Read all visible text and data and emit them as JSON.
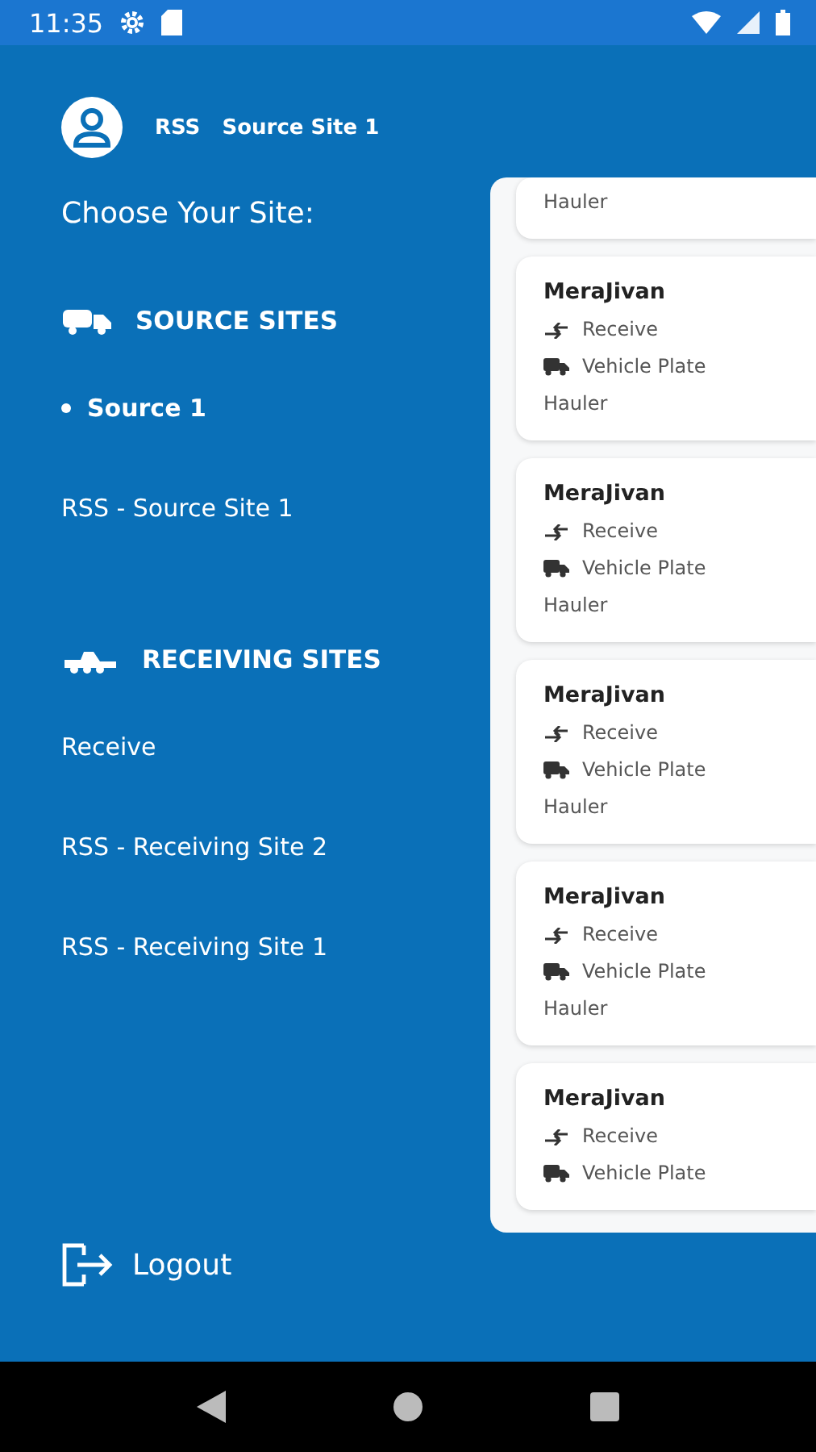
{
  "status_bar": {
    "time": "11:35"
  },
  "user": {
    "prefix": "RSS",
    "site": "Source Site 1"
  },
  "prompt": "Choose Your Site:",
  "sections": [
    {
      "kind": "source",
      "title": "SOURCE SITES",
      "items": [
        {
          "label": "Source 1",
          "selected": true
        },
        {
          "label": "RSS - Source Site 1",
          "selected": false
        }
      ]
    },
    {
      "kind": "receiving",
      "title": "RECEIVING SITES",
      "items": [
        {
          "label": "Receive",
          "selected": false
        },
        {
          "label": "RSS - Receiving Site 2",
          "selected": false
        },
        {
          "label": "RSS - Receiving Site 1",
          "selected": false
        }
      ]
    }
  ],
  "logout": "Logout",
  "cards": [
    {
      "hauler": "Hauler"
    },
    {
      "title": "MeraJivan",
      "action": "Receive",
      "plate": "Vehicle Plate",
      "hauler": "Hauler"
    },
    {
      "title": "MeraJivan",
      "action": "Receive",
      "plate": "Vehicle Plate",
      "hauler": "Hauler"
    },
    {
      "title": "MeraJivan",
      "action": "Receive",
      "plate": "Vehicle Plate",
      "hauler": "Hauler"
    },
    {
      "title": "MeraJivan",
      "action": "Receive",
      "plate": "Vehicle Plate",
      "hauler": "Hauler"
    },
    {
      "title": "MeraJivan",
      "action": "Receive",
      "plate": "Vehicle Plate"
    }
  ]
}
